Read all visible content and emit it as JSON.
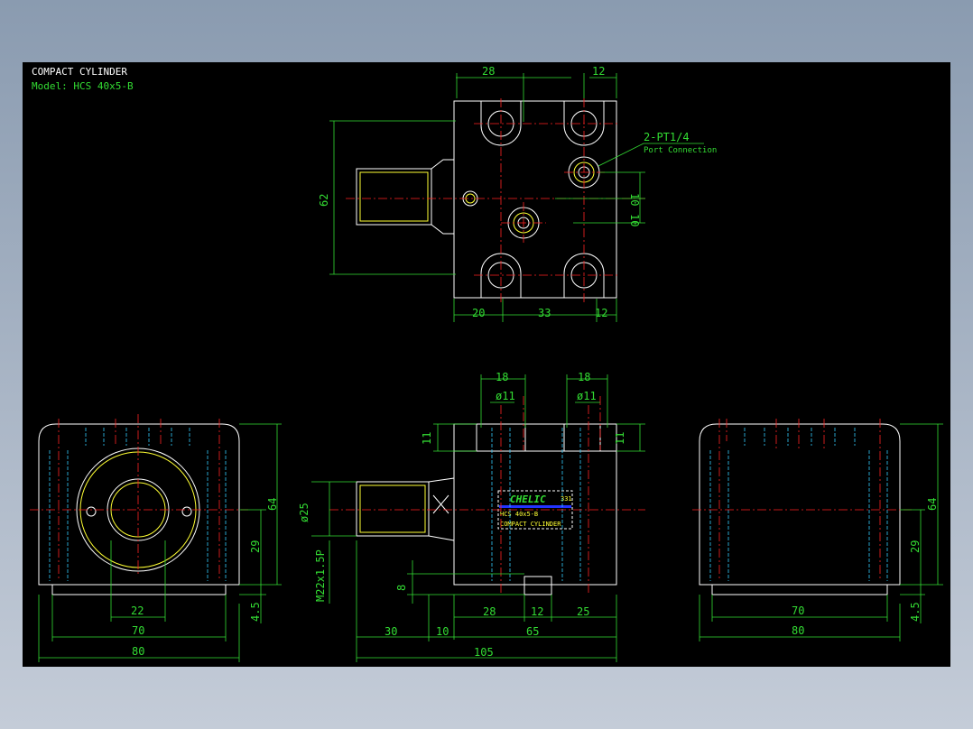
{
  "title": "COMPACT CYLINDER",
  "model": "Model:  HCS  40x5-B",
  "colors": {
    "background": "#000000",
    "outline": "#ffffff",
    "dimension": "#33dd33",
    "center": "#ff2222",
    "hidden": "#33ccff",
    "thread": "#ffff33"
  },
  "port_label": "2-PT1/4",
  "port_sublabel": "Port Connection",
  "nameplate": {
    "brand": "CHELIC",
    "code": "331",
    "model": "HCS  40x5-B",
    "desc": "COMPACT CYLINDER"
  },
  "top_view": {
    "d_28": "28",
    "d_12": "12",
    "d_62": "62",
    "d_10a": "10",
    "d_10b": "10",
    "d_20": "20",
    "d_33": "33",
    "d_12b": "12"
  },
  "front_view": {
    "d_18a": "18",
    "d_11a": "ø11",
    "d_18b": "18",
    "d_11b": "ø11",
    "d_11l": "11",
    "d_11r": "11",
    "d_25": "ø25",
    "d_m22": "M22x1.5P",
    "d_8": "8",
    "d_28": "28",
    "d_12": "12",
    "d_25b": "25",
    "d_30": "30",
    "d_10": "10",
    "d_65": "65",
    "d_105": "105"
  },
  "left_view": {
    "d_64": "64",
    "d_29": "29",
    "d_45": "4.5",
    "d_22": "22",
    "d_70": "70",
    "d_80": "80"
  },
  "right_view": {
    "d_64": "64",
    "d_29": "29",
    "d_45": "4.5",
    "d_70": "70",
    "d_80": "80"
  }
}
